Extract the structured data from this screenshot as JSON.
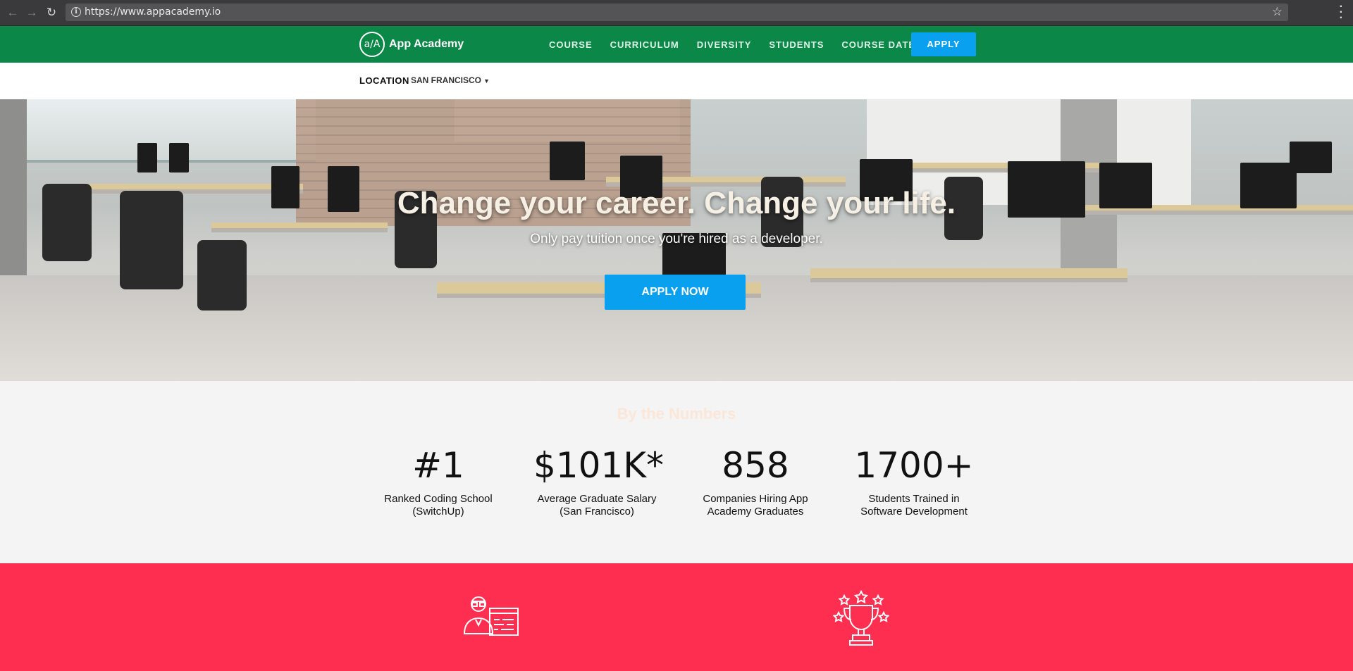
{
  "browser": {
    "url": "https://www.appacademy.io",
    "back_icon": "back-arrow-icon",
    "forward_icon": "forward-arrow-icon",
    "reload_icon": "reload-icon"
  },
  "nav": {
    "logo_mark": "a/A",
    "brand": "App Academy",
    "links": [
      "COURSE",
      "CURRICULUM",
      "DIVERSITY",
      "STUDENTS",
      "COURSE DATES"
    ],
    "apply": "APPLY"
  },
  "location": {
    "label": "LOCATION",
    "value": "SAN FRANCISCO"
  },
  "hero": {
    "title": "Change your career. Change your life.",
    "subtitle": "Only pay tuition once you're hired as a developer.",
    "cta": "APPLY NOW"
  },
  "numbers": {
    "title": "By the Numbers",
    "stats": [
      {
        "value": "#1",
        "label": "Ranked Coding School (SwitchUp)"
      },
      {
        "value": "$101K*",
        "label": "Average Graduate Salary (San Francisco)"
      },
      {
        "value": "858",
        "label": "Companies Hiring App Academy Graduates"
      },
      {
        "value": "1700+",
        "label": "Students Trained in Software Development"
      }
    ]
  },
  "colors": {
    "nav_green": "#0b8847",
    "accent_blue": "#0aa0f0",
    "feature_red": "#fe2e50"
  },
  "icons": [
    "developer-icon",
    "trophy-icon"
  ]
}
